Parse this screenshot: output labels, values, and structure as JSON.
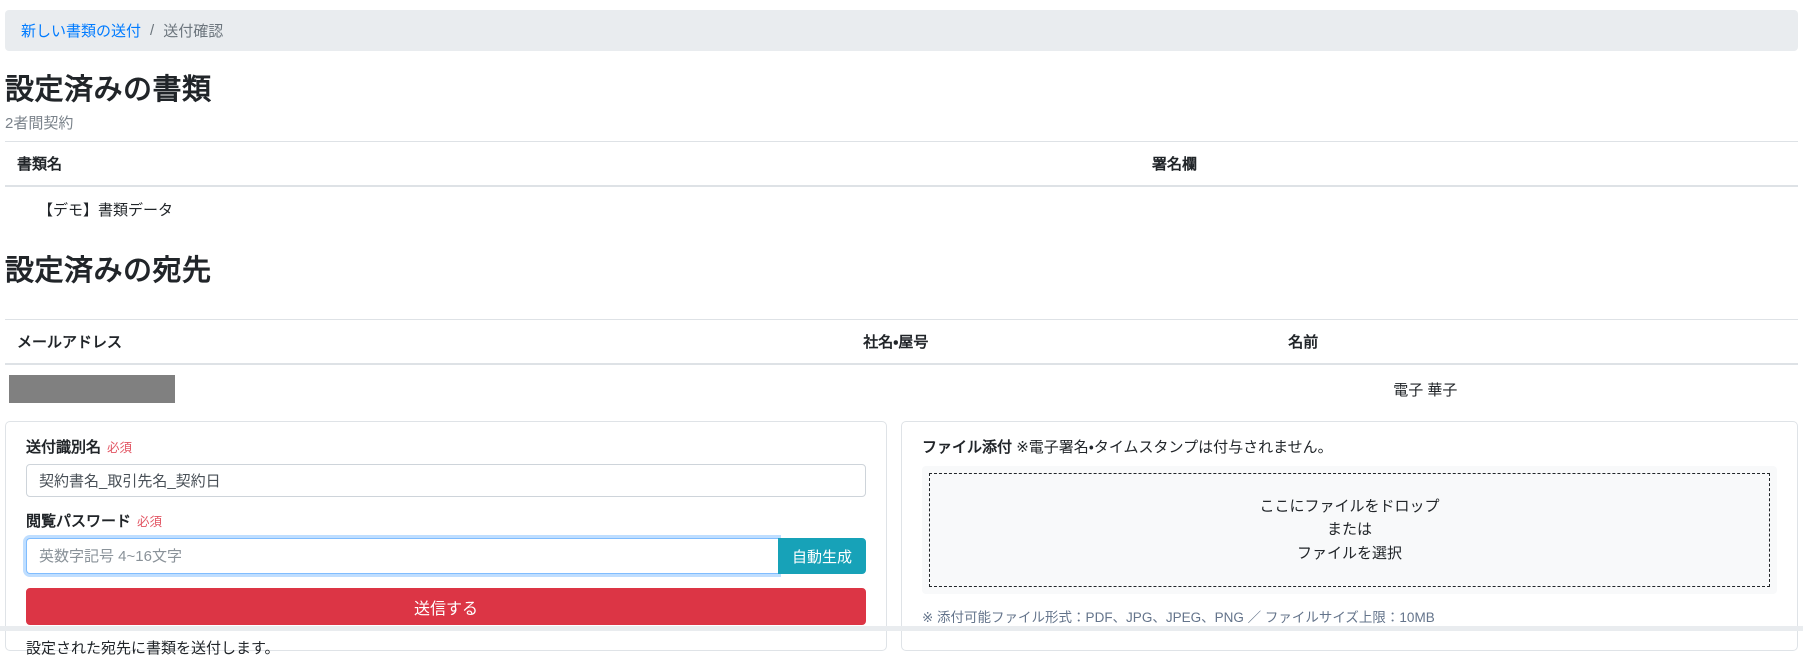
{
  "breadcrumb": {
    "link": "新しい書類の送付",
    "separator": "/",
    "current": "送付確認"
  },
  "documents_section": {
    "title": "設定済みの書類",
    "subtitle": "2者間契約",
    "table": {
      "headers": [
        "書類名",
        "署名欄"
      ],
      "rows": [
        {
          "name": "【デモ】書類データ",
          "signature": ""
        }
      ]
    }
  },
  "recipients_section": {
    "title": "設定済みの宛先",
    "table": {
      "headers": [
        "メールアドレス",
        "社名・屋号",
        "名前"
      ],
      "rows": [
        {
          "email": "",
          "company": "",
          "name": "電子 華子"
        }
      ]
    }
  },
  "send_form": {
    "identifier_label": "送付識別名",
    "required_badge": "必須",
    "identifier_value": "契約書名_取引先名_契約日",
    "password_label": "閲覧パスワード",
    "password_placeholder": "英数字記号 4~16文字",
    "autogenerate_button": "自動生成",
    "submit_button": "送信する",
    "helper_text": "設定された宛先に書類を送付します。"
  },
  "attachment": {
    "title": "ファイル添付",
    "note": "※電子署名・タイムスタンプは付与されません。",
    "dropzone_lines": [
      "ここにファイルをドロップ",
      "または",
      "ファイルを選択"
    ],
    "footnote": "※ 添付可能ファイル形式：PDF、JPG、JPEG、PNG ／ ファイルサイズ上限：10MB"
  },
  "colors": {
    "link_blue": "#007bff",
    "danger_red": "#dc3545",
    "info_teal": "#17a2b8",
    "required_pink": "#e25563",
    "breadcrumb_bg": "#e9ecef",
    "muted_note": "#64748b",
    "redaction_gray": "#808080"
  }
}
